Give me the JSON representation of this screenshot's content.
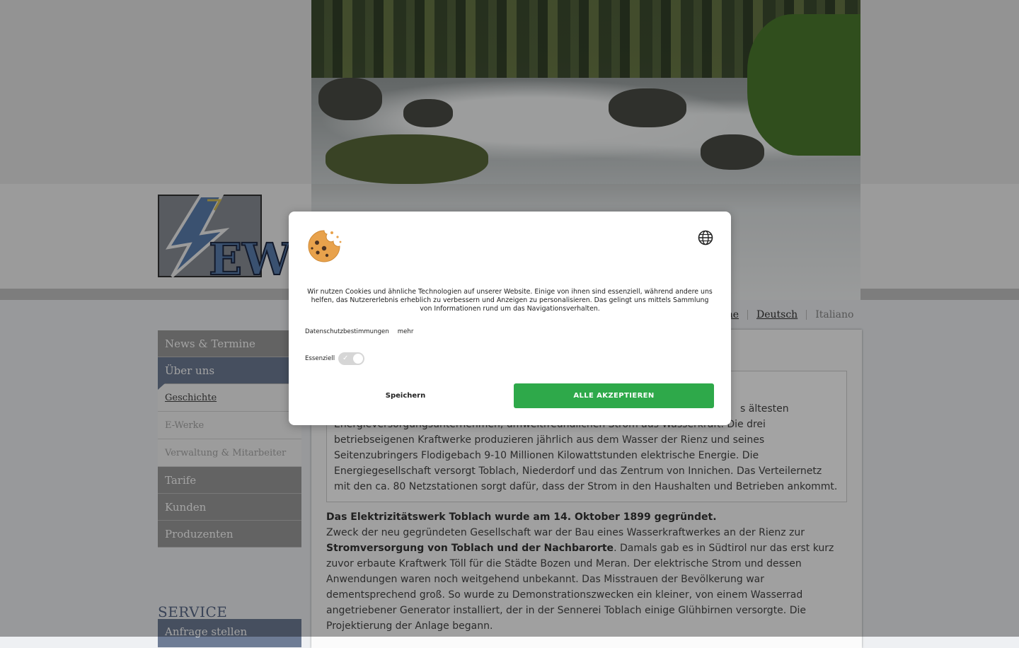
{
  "brand": {
    "logo_text": "EW"
  },
  "languages": {
    "first_partial": "ne",
    "current": "Deutsch",
    "other": "Italiano"
  },
  "sidebar": {
    "items": [
      {
        "label": "News & Termine"
      },
      {
        "label": "Über uns"
      },
      {
        "label": "Geschichte"
      },
      {
        "label": "E-Werke"
      },
      {
        "label": "Verwaltung & Mitarbeiter"
      },
      {
        "label": "Tarife"
      },
      {
        "label": "Kunden"
      },
      {
        "label": "Produzenten"
      }
    ],
    "service_title": "SERVICE",
    "service_button": "Anfrage stellen"
  },
  "content": {
    "intro_lines": [
      "s ältesten",
      "Energieversorgungsunternehmen, umweltfreundlichen Strom aus Wasserkraft. Die drei",
      "betriebseigenen Kraftwerke produzieren jährlich aus dem Wasser der Rienz und seines",
      "Seitenzubringers Flodigebach 9-10 Millionen Kilowattstunden elektrische Energie. Die",
      "Energiegesellschaft versorgt Toblach, Niederdorf und das Zentrum von Innichen. Das Verteilernetz",
      "mit den ca. 80 Netzstationen sorgt dafür, dass der Strom in den Haushalten und Betrieben ankommt."
    ],
    "founded_heading": "Das Elektrizitätswerk Toblach wurde am 14. Oktober 1899 gegründet.",
    "para_part1": "Zweck  der neu gegründeten Gesellschaft war der Bau eines Wasserkraftwerkes an der Rienz zur",
    "para_bold": "Stromversorgung von Toblach und der Nachbarorte",
    "para_part2": ". Damals gab es in Südtirol nur das erst kurz zuvor erbaute Kraftwerk Töll für die Städte Bozen und Meran. Der elektrische Strom und dessen Anwendungen waren noch weitgehend unbekannt. Das Misstrauen der Bevölkerung war dementsprechend groß. So wurde zu Demonstrationszwecken ein kleiner, von einem Wasserrad angetriebener Generator installiert, der in der Sennerei Toblach einige Glühbirnen versorgte. Die Projektierung der Anlage begann."
  },
  "cookie_dialog": {
    "text": "Wir nutzen Cookies und ähnliche Technologien auf unserer Website. Einige von ihnen sind essenziell, während andere uns helfen, das Nutzererlebnis erheblich zu verbessern und Anzeigen zu personalisieren. Das gelingt uns mittels Sammlung von Informationen rund um das Navigationsverhalten.",
    "privacy_link": "Datenschutzbestimmungen",
    "more_link": "mehr",
    "essential_label": "Essenziell",
    "essential_checked": true,
    "save_label": "Speichern",
    "accept_label": "ALLE AKZEPTIEREN",
    "accent_color": "#2ea94a"
  },
  "icons": {
    "cookie": "cookie-icon",
    "language": "globe-icon",
    "check": "✓"
  }
}
